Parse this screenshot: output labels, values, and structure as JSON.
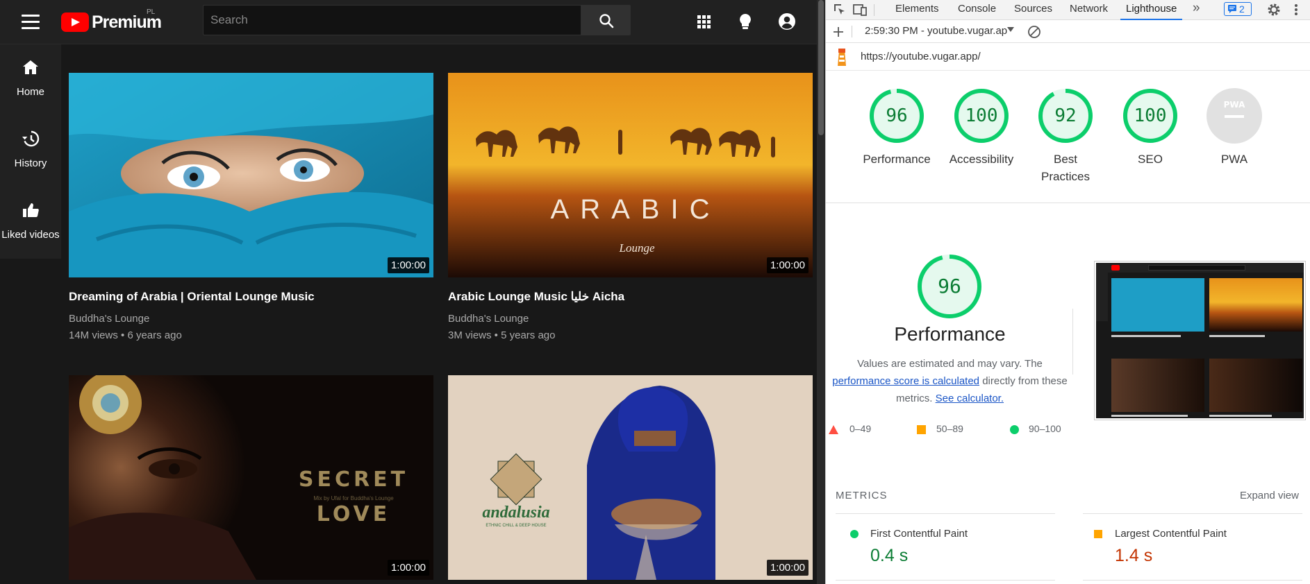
{
  "youtube": {
    "logo_text": "Premium",
    "region": "PL",
    "search_placeholder": "Search",
    "sidebar": [
      {
        "label": "Home",
        "icon": "home-icon"
      },
      {
        "label": "History",
        "icon": "history-icon"
      },
      {
        "label": "Liked videos",
        "icon": "thumbs-up-icon"
      }
    ],
    "videos": [
      {
        "title": "Dreaming of Arabia | Oriental Lounge Music",
        "channel": "Buddha's Lounge",
        "meta": "14M views • 6 years ago",
        "duration": "1:00:00"
      },
      {
        "title": "Arabic Lounge Music خليا Aicha",
        "channel": "Buddha's Lounge",
        "meta": "3M views • 5 years ago",
        "duration": "1:00:00",
        "thumb_text": "ARABIC",
        "thumb_sub": "Lounge"
      },
      {
        "title": "",
        "channel": "",
        "meta": "",
        "duration": "1:00:00",
        "thumb_text": "SECRET",
        "thumb_text2": "LOVE",
        "thumb_sub": "Mix by Ufal for Buddha's Lounge"
      },
      {
        "title": "",
        "channel": "",
        "meta": "",
        "duration": "1:00:00",
        "thumb_text": "andalusia",
        "thumb_sub": "ETHNIC CHILL & DEEP HOUSE"
      }
    ]
  },
  "devtools": {
    "tabs": [
      "Elements",
      "Console",
      "Sources",
      "Network",
      "Lighthouse"
    ],
    "active_tab": "Lighthouse",
    "issues_count": "2",
    "report_selector": "2:59:30 PM - youtube.vugar.ap",
    "url": "https://youtube.vugar.app/",
    "scores": [
      {
        "value": 96,
        "label": "Performance"
      },
      {
        "value": 100,
        "label": "Accessibility"
      },
      {
        "value": 92,
        "label": "Best Practices"
      },
      {
        "value": 100,
        "label": "SEO"
      },
      {
        "value": null,
        "label": "PWA",
        "badge": "PWA"
      }
    ],
    "perf": {
      "score": 96,
      "title": "Performance",
      "desc_1": "Values are estimated and may vary. The",
      "desc_link": "performance score is calculated",
      "desc_2": "directly from these",
      "desc_3": "metrics.",
      "desc_link2": "See calculator.",
      "legend": [
        "0–49",
        "50–89",
        "90–100"
      ]
    },
    "metrics_heading": "METRICS",
    "expand_label": "Expand view",
    "metrics": [
      {
        "name": "First Contentful Paint",
        "value": "0.4 s",
        "status": "good"
      },
      {
        "name": "Largest Contentful Paint",
        "value": "1.4 s",
        "status": "average"
      }
    ],
    "colors": {
      "good": "#0cce6b",
      "average": "#ffa400",
      "poor": "#ff4e42",
      "good_text": "#0a7c33",
      "average_text": "#c33300"
    }
  }
}
